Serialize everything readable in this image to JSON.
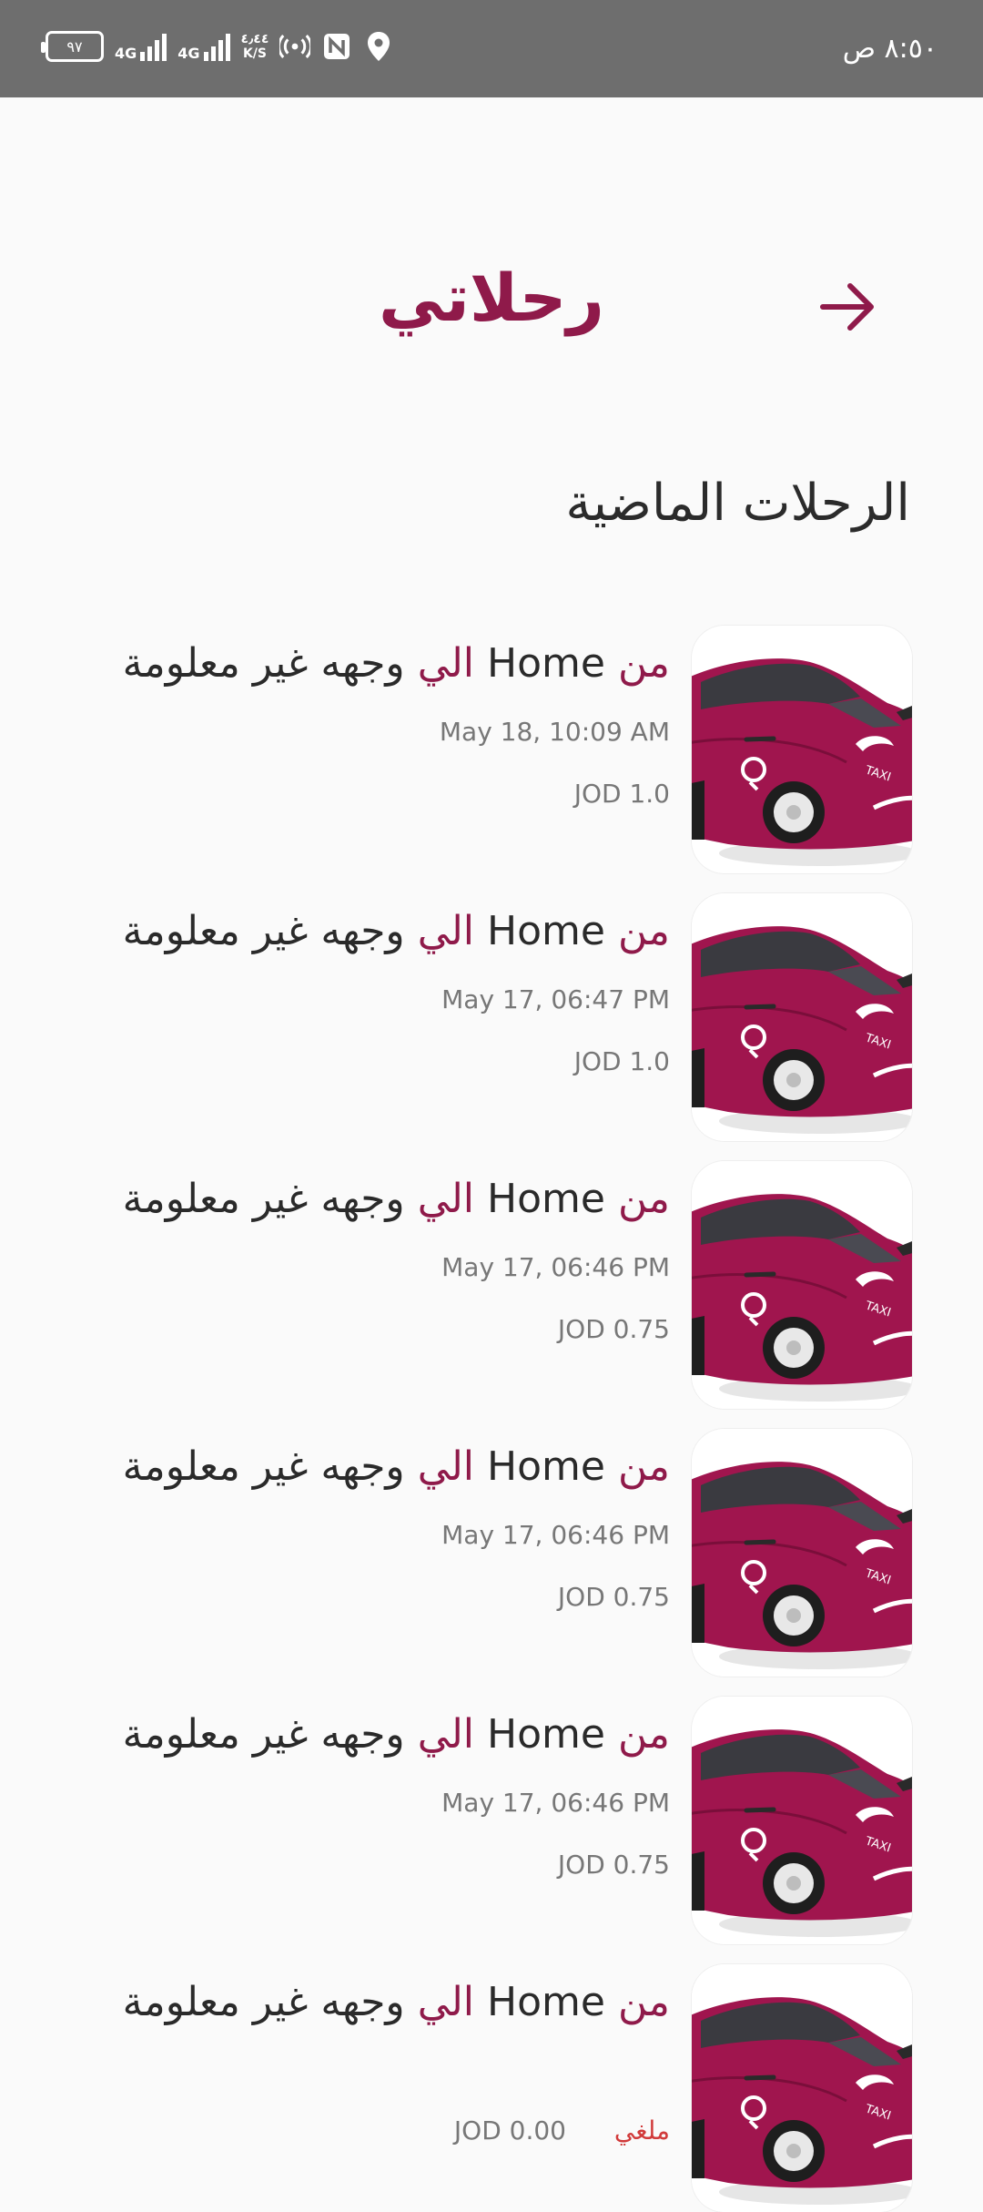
{
  "status_bar": {
    "time": "٨:٥٠ ص",
    "battery": "٩٧",
    "network_1": "4G",
    "network_2": "4G",
    "speed_value": "٤٫٤٤",
    "speed_unit": "K/S"
  },
  "header": {
    "title": "رحلاتي"
  },
  "section": {
    "title": "الرحلات الماضية"
  },
  "trips": [
    {
      "from_word": "من",
      "origin": "Home",
      "to_word": "الي",
      "destination": "وجهه غير معلومة",
      "date": "May 18, 10:09 AM",
      "price": "JOD 1.0"
    },
    {
      "from_word": "من",
      "origin": "Home",
      "to_word": "الي",
      "destination": "وجهه غير معلومة",
      "date": "May 17, 06:47 PM",
      "price": "JOD 1.0"
    },
    {
      "from_word": "من",
      "origin": "Home",
      "to_word": "الي",
      "destination": "وجهه غير معلومة",
      "date": "May 17, 06:46 PM",
      "price": "JOD 0.75"
    },
    {
      "from_word": "من",
      "origin": "Home",
      "to_word": "الي",
      "destination": "وجهه غير معلومة",
      "date": "May 17, 06:46 PM",
      "price": "JOD 0.75"
    },
    {
      "from_word": "من",
      "origin": "Home",
      "to_word": "الي",
      "destination": "وجهه غير معلومة",
      "date": "May 17, 06:46 PM",
      "price": "JOD 0.75"
    },
    {
      "from_word": "من",
      "origin": "Home",
      "to_word": "الي",
      "destination": "وجهه غير معلومة",
      "price": "JOD 0.00",
      "status": "ملغي"
    }
  ],
  "colors": {
    "accent": "#8f1a4a",
    "cancelled": "#d13a3a",
    "car_body": "#a0154e"
  },
  "icons": {
    "back": "arrow-right-icon",
    "car": "taxi-car-icon"
  }
}
